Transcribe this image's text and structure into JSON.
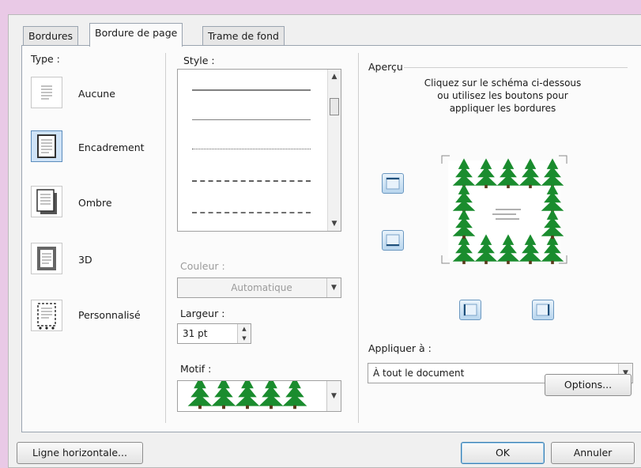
{
  "tabs": [
    {
      "label": "Bordures",
      "underline": "B"
    },
    {
      "label": "Bordure de page",
      "underline": "p"
    },
    {
      "label": "Trame de fond",
      "underline": "T"
    }
  ],
  "type": {
    "label": "Type :",
    "options": [
      {
        "label": "Aucune",
        "icon": "no-border-icon"
      },
      {
        "label": "Encadrement",
        "icon": "box-border-icon",
        "selected": true
      },
      {
        "label": "Ombre",
        "icon": "shadow-border-icon"
      },
      {
        "label": "3D",
        "icon": "3d-border-icon"
      },
      {
        "label": "Personnalisé",
        "icon": "custom-border-icon"
      }
    ]
  },
  "style": {
    "label": "Style :",
    "lines": [
      "solid-thick",
      "solid-thin",
      "dotted",
      "dashed",
      "dash-dot"
    ]
  },
  "color": {
    "label": "Couleur :",
    "value": "Automatique"
  },
  "width": {
    "label": "Largeur :",
    "value": "31 pt"
  },
  "art": {
    "label": "Motif :",
    "value": "trees"
  },
  "preview": {
    "label": "Aperçu",
    "instructions": [
      "Cliquez sur le schéma ci-dessous",
      "ou utilisez les boutons pour",
      "appliquer les bordures"
    ]
  },
  "apply_to": {
    "label": "Appliquer à :",
    "value": "À tout le document"
  },
  "buttons": {
    "options": "Options...",
    "horizontal_line": "Ligne horizontale...",
    "ok": "OK",
    "cancel": "Annuler"
  },
  "colors": {
    "tree": "#1a8c2e",
    "selection": "#cfe3f7",
    "accent": "#3c7fb1"
  }
}
